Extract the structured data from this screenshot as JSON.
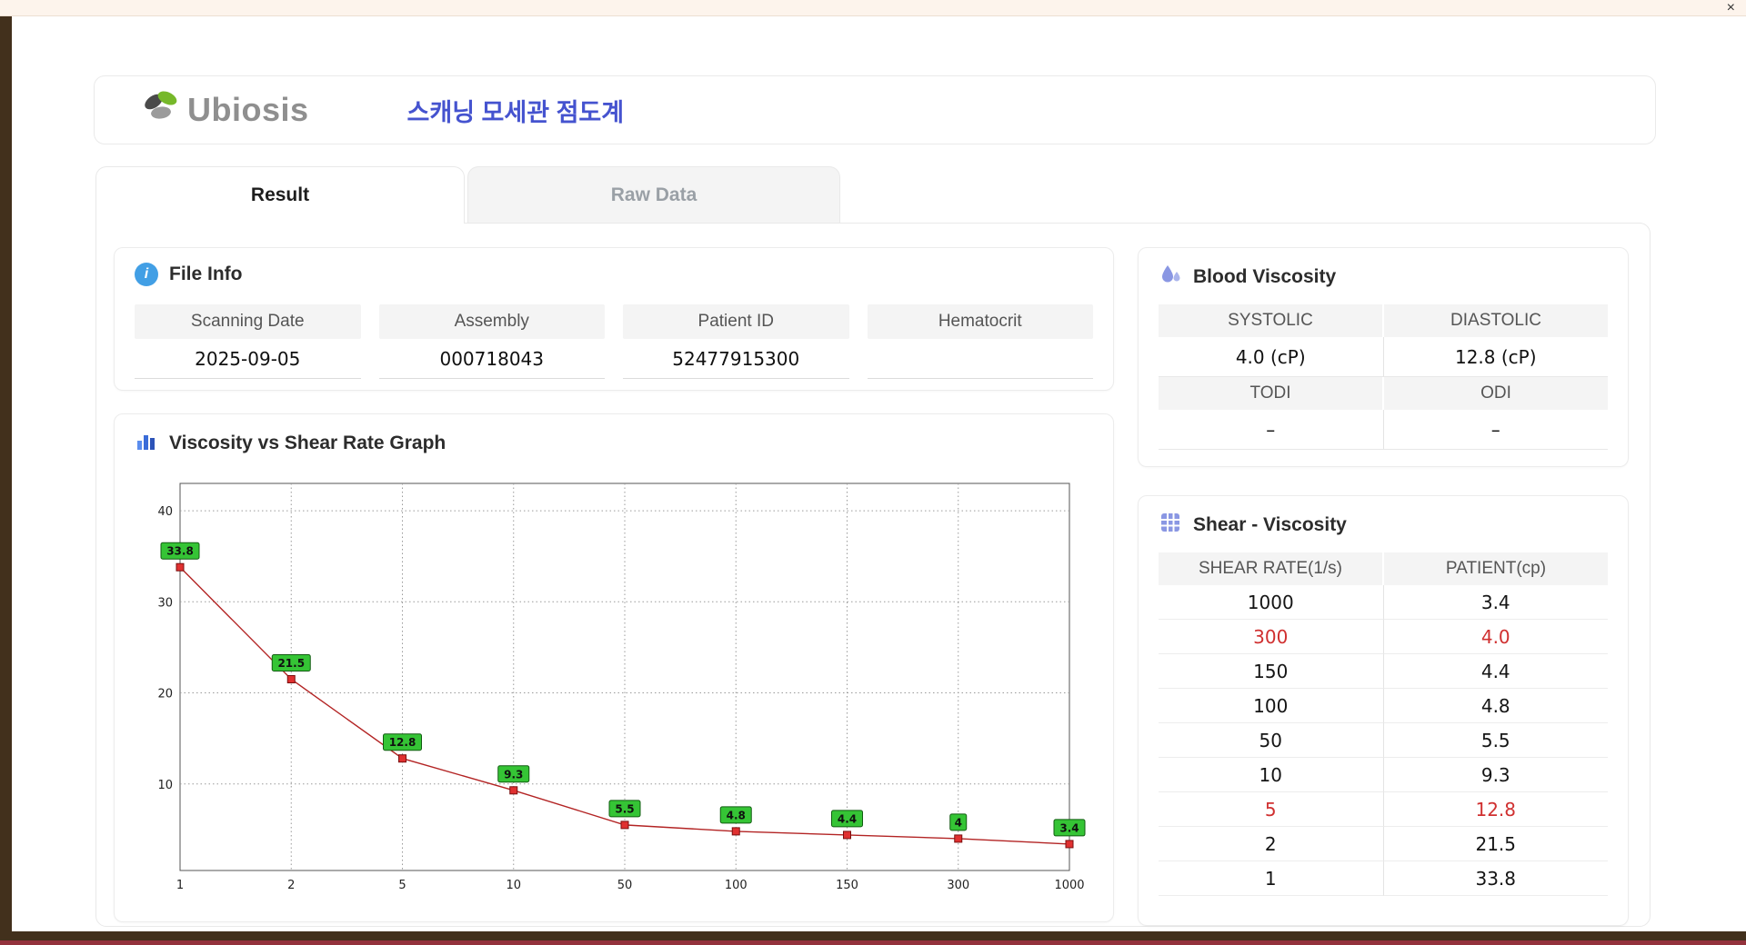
{
  "window": {
    "close_icon": "×"
  },
  "icons": {
    "info": "i"
  },
  "header": {
    "brand": "Ubiosis",
    "title": "스캐닝 모세관 점도계"
  },
  "tabs": {
    "result": "Result",
    "raw_data": "Raw Data"
  },
  "file_info": {
    "title": "File Info",
    "fields": [
      {
        "label": "Scanning Date",
        "value": "2025-09-05"
      },
      {
        "label": "Assembly",
        "value": "000718043"
      },
      {
        "label": "Patient ID",
        "value": "52477915300"
      },
      {
        "label": "Hematocrit",
        "value": ""
      }
    ]
  },
  "blood_viscosity": {
    "title": "Blood Viscosity",
    "systolic_label": "SYSTOLIC",
    "diastolic_label": "DIASTOLIC",
    "systolic_value": "4.0 (cP)",
    "diastolic_value": "12.8 (cP)",
    "todi_label": "TODI",
    "odi_label": "ODI",
    "todi_value": "–",
    "odi_value": "–"
  },
  "graph": {
    "title": "Viscosity vs Shear Rate Graph"
  },
  "shear_viscosity": {
    "title": "Shear - Viscosity",
    "columns": [
      "SHEAR RATE(1/s)",
      "PATIENT(cp)"
    ],
    "highlight_color": "#d03030",
    "rows": [
      {
        "shear_rate": "1000",
        "patient": "3.4",
        "highlight": false
      },
      {
        "shear_rate": "300",
        "patient": "4.0",
        "highlight": true
      },
      {
        "shear_rate": "150",
        "patient": "4.4",
        "highlight": false
      },
      {
        "shear_rate": "100",
        "patient": "4.8",
        "highlight": false
      },
      {
        "shear_rate": "50",
        "patient": "5.5",
        "highlight": false
      },
      {
        "shear_rate": "10",
        "patient": "9.3",
        "highlight": false
      },
      {
        "shear_rate": "5",
        "patient": "12.8",
        "highlight": true
      },
      {
        "shear_rate": "2",
        "patient": "21.5",
        "highlight": false
      },
      {
        "shear_rate": "1",
        "patient": "33.8",
        "highlight": false
      }
    ]
  },
  "chart_data": {
    "type": "line",
    "title": "Viscosity vs Shear Rate Graph",
    "xlabel": "",
    "ylabel": "",
    "x_labels": [
      "1",
      "2",
      "5",
      "10",
      "50",
      "100",
      "150",
      "300",
      "1000"
    ],
    "x_values": [
      1,
      2,
      5,
      10,
      50,
      100,
      150,
      300,
      1000
    ],
    "values": [
      33.8,
      21.5,
      12.8,
      9.3,
      5.5,
      4.8,
      4.4,
      4.0,
      3.4
    ],
    "point_labels": [
      "33.8",
      "21.5",
      "12.8",
      "9.3",
      "5.5",
      "4.8",
      "4.4",
      "4",
      "3.4"
    ],
    "y_ticks": [
      10,
      20,
      30,
      40
    ],
    "ylim": [
      0.5,
      43
    ],
    "grid": "dotted",
    "legend": "none",
    "line_color": "#b32424",
    "marker_color": "#e03030",
    "marker_border": "#7a0f0f",
    "point_label_bg": "#35c435",
    "point_label_border": "#115c11"
  },
  "colors": {
    "accent_blue": "#4553cf",
    "icon_indigo": "#8a97e3",
    "info_blue": "#429fe5",
    "brand_green": "#76b82a",
    "highlight_red": "#d03030",
    "chrome_brown": "#42301c",
    "chrome_maroon": "#93323c"
  }
}
